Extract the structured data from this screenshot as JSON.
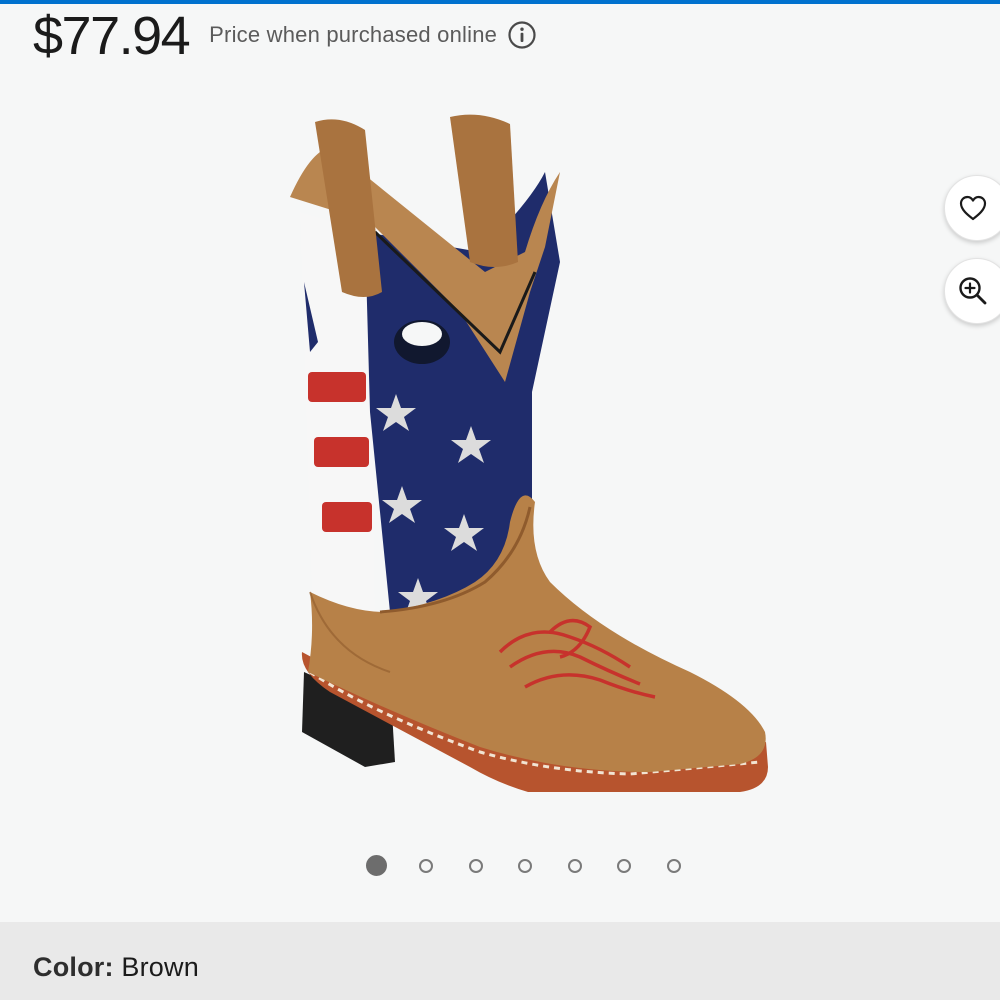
{
  "price": {
    "amount": "$77.94",
    "note": "Price when purchased online",
    "info_icon": "info-icon"
  },
  "gallery": {
    "image_alt": "Brown and American flag western boot",
    "favorite_icon": "heart-icon",
    "zoom_icon": "zoom-in-icon",
    "dot_count": 7,
    "active_index": 0
  },
  "variant": {
    "label": "Color:",
    "value": "Brown"
  },
  "colors": {
    "accent": "#0071ce",
    "background": "#f6f7f7",
    "bar": "#e9e9e9"
  }
}
